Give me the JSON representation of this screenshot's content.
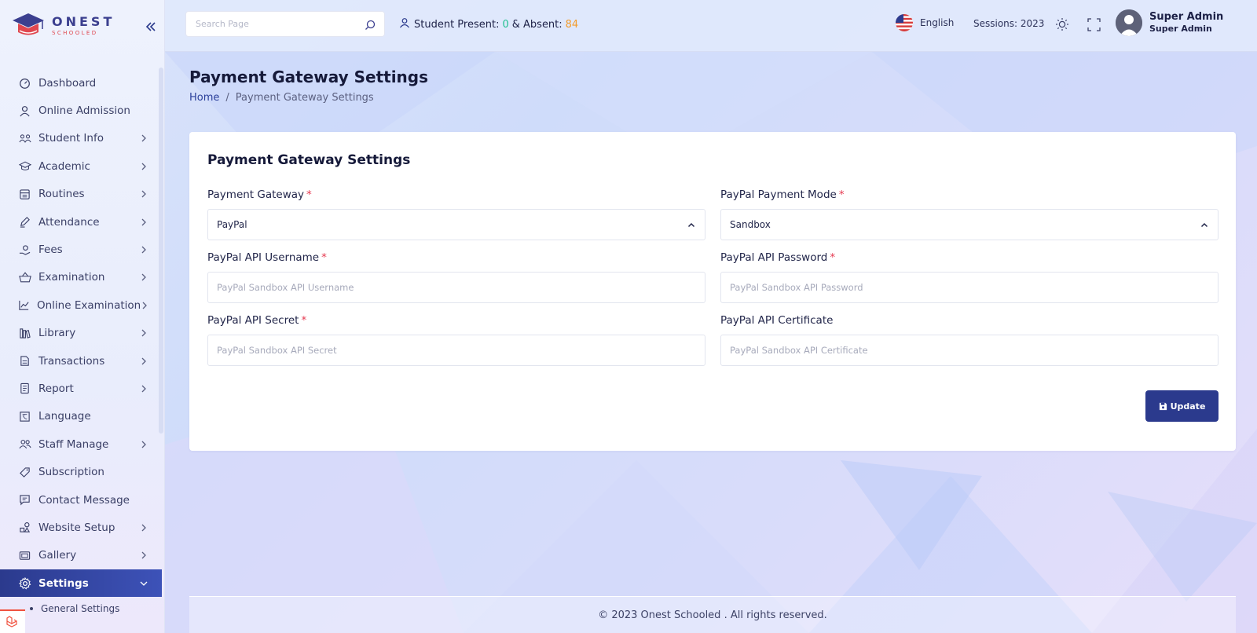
{
  "brand": {
    "name": "ONEST",
    "tagline": "SCHOOLED"
  },
  "sidebar": {
    "items": [
      {
        "label": "Dashboard",
        "icon": "dashboard-icon",
        "has_children": false
      },
      {
        "label": "Online Admission",
        "icon": "user-icon",
        "has_children": false
      },
      {
        "label": "Student Info",
        "icon": "students-icon",
        "has_children": true
      },
      {
        "label": "Academic",
        "icon": "graduation-cap-icon",
        "has_children": true
      },
      {
        "label": "Routines",
        "icon": "calendar-icon",
        "has_children": true
      },
      {
        "label": "Attendance",
        "icon": "pen-icon",
        "has_children": true
      },
      {
        "label": "Fees",
        "icon": "coin-hand-icon",
        "has_children": true
      },
      {
        "label": "Examination",
        "icon": "basket-icon",
        "has_children": true
      },
      {
        "label": "Online Examination",
        "icon": "chart-icon",
        "has_children": true
      },
      {
        "label": "Library",
        "icon": "books-icon",
        "has_children": true
      },
      {
        "label": "Transactions",
        "icon": "transactions-icon",
        "has_children": true
      },
      {
        "label": "Report",
        "icon": "document-icon",
        "has_children": true
      },
      {
        "label": "Language",
        "icon": "language-icon",
        "has_children": false
      },
      {
        "label": "Staff Manage",
        "icon": "users-icon",
        "has_children": true
      },
      {
        "label": "Subscription",
        "icon": "tag-icon",
        "has_children": false
      },
      {
        "label": "Contact Message",
        "icon": "message-icon",
        "has_children": false
      },
      {
        "label": "Website Setup",
        "icon": "shapes-icon",
        "has_children": true
      },
      {
        "label": "Gallery",
        "icon": "gallery-icon",
        "has_children": true
      },
      {
        "label": "Settings",
        "icon": "gear-icon",
        "has_children": true,
        "active": true
      }
    ],
    "sub_items": [
      {
        "label": "General Settings"
      }
    ]
  },
  "header": {
    "search_placeholder": "Search Page",
    "attendance": {
      "present_label": "Student Present:",
      "present": "0",
      "joiner": "& Absent:",
      "absent": "84"
    },
    "language": "English",
    "sessions": "Sessions: 2023",
    "user": {
      "name": "Super Admin",
      "role": "Super Admin"
    }
  },
  "page": {
    "title": "Payment Gateway Settings",
    "breadcrumb": {
      "home": "Home",
      "separator": "/",
      "current": "Payment Gateway Settings"
    }
  },
  "form": {
    "title": "Payment Gateway Settings",
    "required_mark": "*",
    "fields": {
      "gateway": {
        "label": "Payment Gateway",
        "value": "PayPal"
      },
      "mode": {
        "label": "PayPal Payment Mode",
        "value": "Sandbox"
      },
      "username": {
        "label": "PayPal API Username",
        "value": "",
        "placeholder": "PayPal Sandbox API Username"
      },
      "password": {
        "label": "PayPal API Password",
        "value": "",
        "placeholder": "PayPal Sandbox API Password"
      },
      "secret": {
        "label": "PayPal API Secret",
        "value": "",
        "placeholder": "PayPal Sandbox API Secret"
      },
      "certificate": {
        "label": "PayPal API Certificate",
        "value": "",
        "placeholder": "PayPal Sandbox API Certificate"
      }
    },
    "submit_label": "Update"
  },
  "footer": {
    "text": "© 2023 Onest Schooled . All rights reserved."
  },
  "colors": {
    "primary": "#2b3a8d",
    "present": "#1fbf8f",
    "absent": "#f39c2c",
    "required": "#e53950",
    "laravel": "#f05340"
  }
}
